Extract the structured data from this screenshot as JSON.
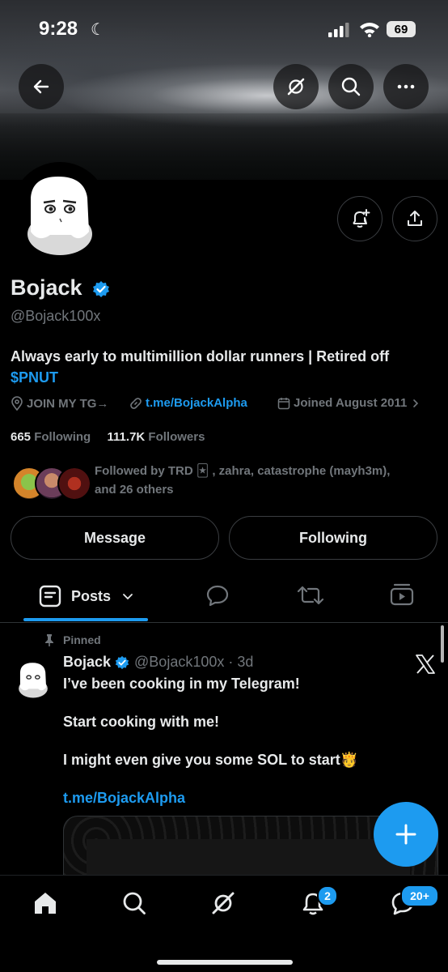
{
  "status_bar": {
    "time": "9:28",
    "battery": "69"
  },
  "profile": {
    "name": "Bojack",
    "handle": "@Bojack100x",
    "bio_line1": "Always early to multimillion dollar runners | Retired off",
    "bio_ticker": "$PNUT",
    "location": "JOIN MY TG→",
    "link": "t.me/BojackAlpha",
    "joined": "Joined August 2011",
    "following_count": "665",
    "following_label": "Following",
    "followers_count": "111.7K",
    "followers_label": "Followers",
    "followed_by_line1": "Followed by TRD 🃏 , zahra, catastrophe (mayh3m),",
    "followed_by_line2": "and 26 others"
  },
  "buttons": {
    "message": "Message",
    "following": "Following"
  },
  "tabs": {
    "posts": "Posts"
  },
  "pinned_post": {
    "pinned_label": "Pinned",
    "author": "Bojack",
    "handle_time": "@Bojack100x · 3d",
    "line1": "I’ve been cooking in my Telegram!",
    "line2": "Start cooking with me!",
    "line3": "I might even give you some SOL to start🫅",
    "link": "t.me/BojackAlpha"
  },
  "bottom_nav": {
    "notifications_badge": "2",
    "messages_badge": "20+"
  },
  "colors": {
    "accent": "#1d9bf0",
    "background": "#000000",
    "secondary_text": "#71767b"
  },
  "icons": [
    "back-arrow-icon",
    "grok-icon",
    "search-icon",
    "more-icon",
    "bell-plus-icon",
    "share-icon",
    "location-icon",
    "link-icon",
    "calendar-icon",
    "chevron-right-icon",
    "posts-tab-icon",
    "chevron-down-icon",
    "replies-icon",
    "retweet-icon",
    "media-icon",
    "pin-icon",
    "x-logo-icon",
    "compose-plus-icon",
    "home-icon",
    "notifications-icon",
    "messages-icon"
  ]
}
